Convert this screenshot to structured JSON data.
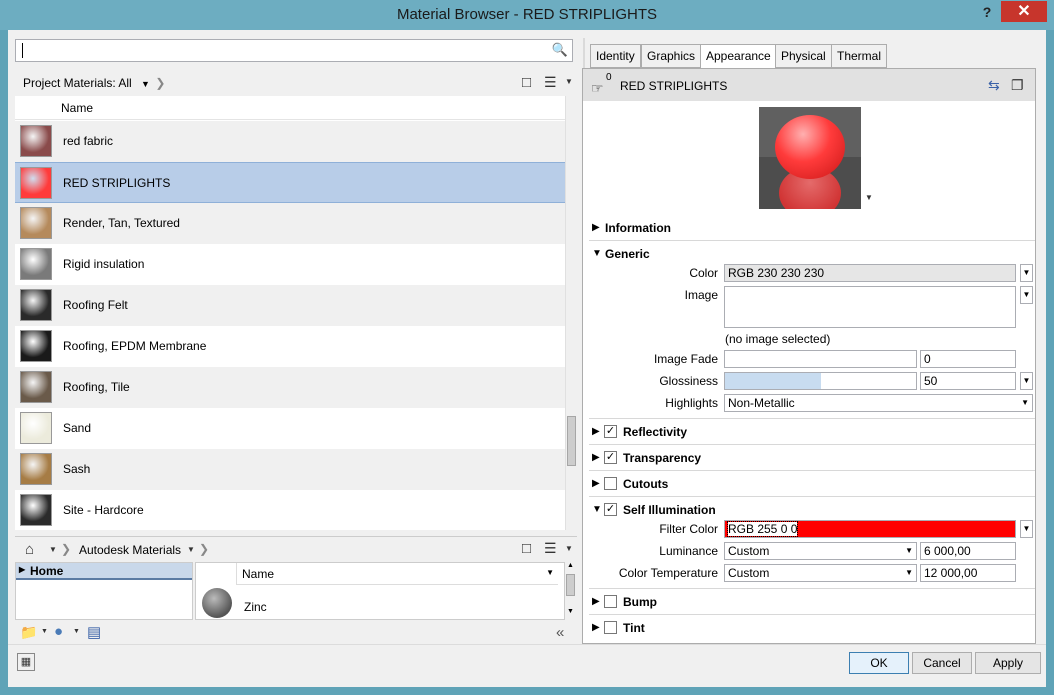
{
  "window": {
    "title": "Material Browser - RED STRIPLIGHTS",
    "help_label": "?",
    "close_label": "✕"
  },
  "search": {
    "value": "",
    "placeholder": ""
  },
  "project_breadcrumb": "Project Materials: All",
  "project_list": {
    "column_header": "Name",
    "items": [
      {
        "label": "red fabric",
        "thumb_color": "#8a4b4b"
      },
      {
        "label": "RED STRIPLIGHTS",
        "thumb_color": "#ff3b3b",
        "selected": true
      },
      {
        "label": "Render, Tan, Textured",
        "thumb_color": "#b58a5c"
      },
      {
        "label": "Rigid insulation",
        "thumb_color": "#7a7a7a"
      },
      {
        "label": "Roofing Felt",
        "thumb_color": "#2a2a2a"
      },
      {
        "label": "Roofing, EPDM Membrane",
        "thumb_color": "#1a1a1a"
      },
      {
        "label": "Roofing, Tile",
        "thumb_color": "#6a5a4a"
      },
      {
        "label": "Sand",
        "thumb_color": "#ecebdc"
      },
      {
        "label": "Sash",
        "thumb_color": "#a67c45"
      },
      {
        "label": "Site - Hardcore",
        "thumb_color": "#2b2b2b"
      }
    ]
  },
  "library": {
    "breadcrumb": "Autodesk Materials",
    "tree_home": "Home",
    "column_header": "Name",
    "items": [
      {
        "label": "Zinc"
      }
    ]
  },
  "tabs": [
    "Identity",
    "Graphics",
    "Appearance",
    "Physical",
    "Thermal"
  ],
  "active_tab": "Appearance",
  "asset": {
    "name": "RED STRIPLIGHTS",
    "user_count": "0"
  },
  "sections": {
    "information": "Information",
    "generic": "Generic",
    "reflectivity": "Reflectivity",
    "transparency": "Transparency",
    "cutouts": "Cutouts",
    "self_illumination": "Self Illumination",
    "bump": "Bump",
    "tint": "Tint"
  },
  "generic": {
    "color_label": "Color",
    "color_value": "RGB 230 230 230",
    "image_label": "Image",
    "image_note": "(no image selected)",
    "image_fade_label": "Image Fade",
    "image_fade_value": "0",
    "glossiness_label": "Glossiness",
    "glossiness_value": "50",
    "glossiness_fill": 0.5,
    "highlights_label": "Highlights",
    "highlights_value": "Non-Metallic"
  },
  "self_illumination": {
    "filter_color_label": "Filter Color",
    "filter_color_value": "RGB 255 0 0",
    "filter_color_hex": "#ff0000",
    "luminance_label": "Luminance",
    "luminance_mode": "Custom",
    "luminance_value": "6 000,00",
    "color_temp_label": "Color Temperature",
    "color_temp_mode": "Custom",
    "color_temp_value": "12 000,00"
  },
  "buttons": {
    "ok": "OK",
    "cancel": "Cancel",
    "apply": "Apply"
  }
}
